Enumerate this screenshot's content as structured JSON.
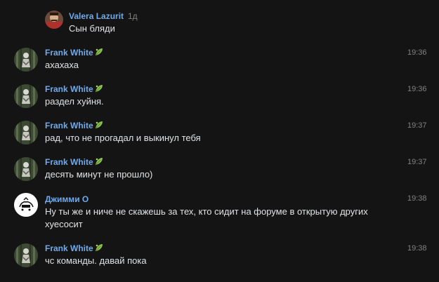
{
  "messages": [
    {
      "author": "Valera Lazurit",
      "time": "1д",
      "text": "Сын бляди",
      "avatar": "avatar-portrait-red"
    },
    {
      "author": "Frank White",
      "time": "19:36",
      "text": "ахахаха",
      "avatar": "avatar-forest-figure",
      "badge": "leaf-icon"
    },
    {
      "author": "Frank White",
      "time": "19:36",
      "text": "раздел хуйня.",
      "avatar": "avatar-forest-figure",
      "badge": "leaf-icon"
    },
    {
      "author": "Frank White",
      "time": "19:37",
      "text": "рад, что не прогадал и выкинул тебя",
      "avatar": "avatar-forest-figure",
      "badge": "leaf-icon"
    },
    {
      "author": "Frank White",
      "time": "19:37",
      "text": "десять минут не прошло)",
      "avatar": "avatar-forest-figure",
      "badge": "leaf-icon"
    },
    {
      "author": "Джимми О",
      "time": "19:38",
      "text": "Ну ты же и ниче не скажешь за тех, кто сидит на форуме в открытую других хуесосит",
      "avatar": "avatar-logo-white"
    },
    {
      "author": "Frank White",
      "time": "19:38",
      "text": "чс команды. давай пока",
      "avatar": "avatar-forest-figure",
      "badge": "leaf-icon"
    }
  ],
  "colors": {
    "background": "#141414",
    "author": "#71aaeb",
    "text": "#e1e3e6",
    "time": "#828282",
    "leaf": "#8bc34a"
  }
}
